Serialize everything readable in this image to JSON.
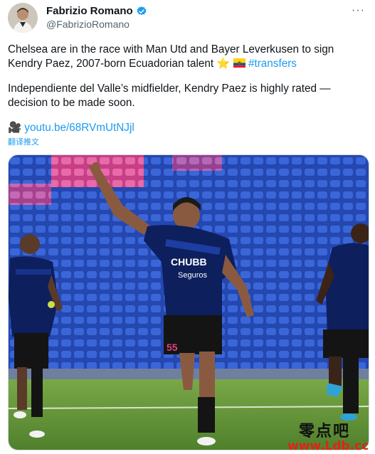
{
  "author": {
    "name": "Fabrizio Romano",
    "handle": "@FabrizioRomano"
  },
  "menu_glyph": "···",
  "tweet": {
    "paragraph1": "Chelsea are in the race with Man Utd and Bayer Leverkusen to sign Kendry Paez, 2007-born Ecuadorian talent ",
    "emoji_star": "⭐️",
    "flag_name": "Ecuador flag",
    "hashtag": "#transfers",
    "paragraph2": "Independiente del Valle’s midfielder, Kendry Paez is highly rated — decision to be made soon.",
    "camera_glyph": "🎥",
    "link_text": "youtu.be/68RVmUtNJjl"
  },
  "translate_label": "翻译推文",
  "media": {
    "shirt_sponsor": "CHUBB",
    "shirt_sub": "Seguros",
    "shorts_number": "55"
  },
  "watermark": {
    "line1": "零点吧",
    "line2": "www.Ldb.cc"
  },
  "colors": {
    "verified": "#1d9bf0",
    "link": "#1d9bf0",
    "kit_blue": "#0d1f5c",
    "seats_blue": "#2f56c8",
    "seats_pink": "#e04f9a",
    "pitch": "#5d8f34",
    "watermark_red": "#e0231c"
  }
}
